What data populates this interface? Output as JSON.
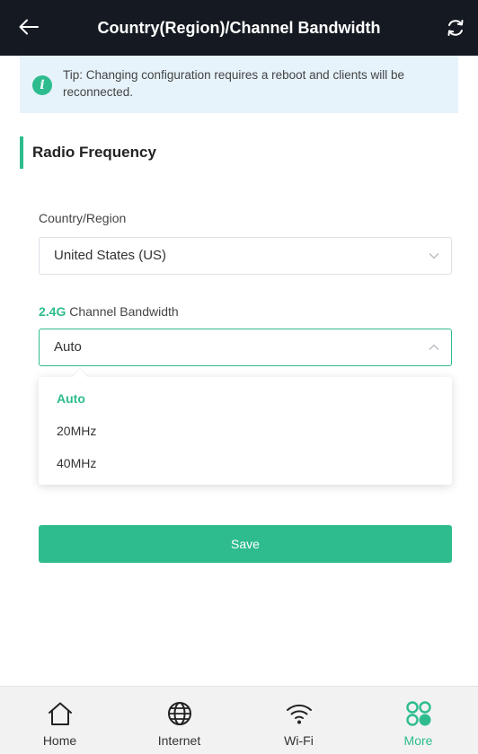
{
  "header": {
    "title": "Country(Region)/Channel Bandwidth",
    "back_icon": "arrow-left-icon",
    "refresh_icon": "refresh-icon"
  },
  "tip": {
    "icon": "info-icon",
    "text": "Tip: Changing configuration requires a reboot and clients will be reconnected."
  },
  "section": {
    "title": "Radio Frequency"
  },
  "country": {
    "label": "Country/Region",
    "value": "United States (US)"
  },
  "bandwidth": {
    "label_band": "2.4G",
    "label_rest": " Channel Bandwidth",
    "value": "Auto",
    "options": [
      "Auto",
      "20MHz",
      "40MHz"
    ],
    "selected": "Auto"
  },
  "actions": {
    "save_label": "Save"
  },
  "tabbar": {
    "items": [
      {
        "label": "Home",
        "icon": "home-icon"
      },
      {
        "label": "Internet",
        "icon": "globe-icon"
      },
      {
        "label": "Wi-Fi",
        "icon": "wifi-icon"
      },
      {
        "label": "More",
        "icon": "more-icon",
        "active": true
      }
    ]
  },
  "colors": {
    "accent": "#2ebc8f",
    "header_bg": "#151a22",
    "tip_bg": "#e6f3fb"
  }
}
